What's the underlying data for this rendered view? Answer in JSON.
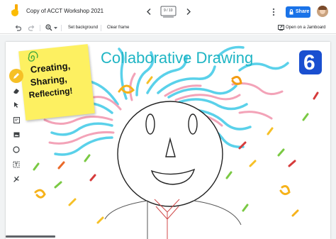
{
  "header": {
    "title": "Copy of ACCT Workshop 2021",
    "frame_counter": "9 / 10",
    "share_label": "Share"
  },
  "toolbar": {
    "set_background": "Set background",
    "clear_frame": "Clear frame",
    "open_jamboard": "Open on a Jamboard"
  },
  "board": {
    "title": "Collaborative Drawing",
    "sticky_note": [
      "Creating,",
      "Sharing,",
      "Reflecting!"
    ],
    "frame_number": "6"
  },
  "colors": {
    "accent": "#1a73e8",
    "sticky": "#fdf061",
    "title_text": "#1fb5c4",
    "badge_bg": "#1a4fd0",
    "pen_active": "#f6c026"
  },
  "icons": {
    "logo": "jamboard-logo-icon",
    "undo": "undo-icon",
    "redo": "redo-icon",
    "zoom": "zoom-icon",
    "pen": "pen-icon",
    "eraser": "eraser-icon",
    "select": "select-arrow-icon",
    "sticky": "sticky-note-icon",
    "image": "image-icon",
    "circle": "circle-shape-icon",
    "textbox": "textbox-icon",
    "laser": "laser-icon"
  }
}
